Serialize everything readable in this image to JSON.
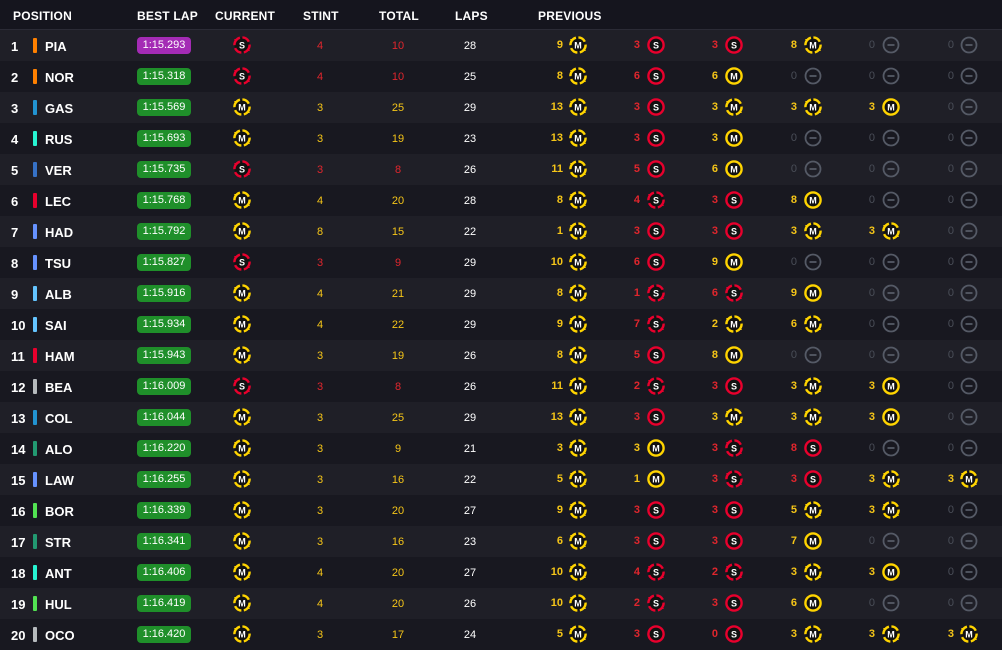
{
  "headers": {
    "position": "POSITION",
    "best_lap": "BEST LAP",
    "current": "CURRENT",
    "stint": "STINT",
    "total": "TOTAL",
    "laps": "LAPS",
    "previous": "PREVIOUS"
  },
  "colors": {
    "soft": "#e8002d",
    "medium": "#ffd400",
    "empty": "#555a66",
    "fastest_lap_purple": "#a42bb5",
    "lap_green": "#1f8f2a",
    "stint_soft_text": "#e0262d",
    "stint_medium_text": "#f5c518"
  },
  "rows": [
    {
      "pos": "1",
      "team_color": "#ff8000",
      "driver": "PIA",
      "best_lap": "1:15.293",
      "purple": true,
      "current": {
        "c": "S",
        "u": true
      },
      "stint": "4",
      "total": "10",
      "laps": "28",
      "prev": [
        {
          "n": "9",
          "c": "M",
          "u": true
        },
        {
          "n": "3",
          "c": "S",
          "u": false
        },
        {
          "n": "3",
          "c": "S",
          "u": false
        },
        {
          "n": "8",
          "c": "M",
          "u": true
        },
        {
          "n": "0",
          "c": "E"
        },
        {
          "n": "0",
          "c": "E"
        }
      ]
    },
    {
      "pos": "2",
      "team_color": "#ff8000",
      "driver": "NOR",
      "best_lap": "1:15.318",
      "purple": false,
      "current": {
        "c": "S",
        "u": true
      },
      "stint": "4",
      "total": "10",
      "laps": "25",
      "prev": [
        {
          "n": "8",
          "c": "M",
          "u": true
        },
        {
          "n": "6",
          "c": "S",
          "u": false
        },
        {
          "n": "6",
          "c": "M",
          "u": false
        },
        {
          "n": "0",
          "c": "E"
        },
        {
          "n": "0",
          "c": "E"
        },
        {
          "n": "0",
          "c": "E"
        }
      ]
    },
    {
      "pos": "3",
      "team_color": "#2293d1",
      "driver": "GAS",
      "best_lap": "1:15.569",
      "purple": false,
      "current": {
        "c": "M",
        "u": true
      },
      "stint": "3",
      "total": "25",
      "laps": "29",
      "prev": [
        {
          "n": "13",
          "c": "M",
          "u": true
        },
        {
          "n": "3",
          "c": "S",
          "u": false
        },
        {
          "n": "3",
          "c": "M",
          "u": true
        },
        {
          "n": "3",
          "c": "M",
          "u": true
        },
        {
          "n": "3",
          "c": "M",
          "u": false
        },
        {
          "n": "0",
          "c": "E"
        }
      ]
    },
    {
      "pos": "4",
      "team_color": "#27f4d2",
      "driver": "RUS",
      "best_lap": "1:15.693",
      "purple": false,
      "current": {
        "c": "M",
        "u": true
      },
      "stint": "3",
      "total": "19",
      "laps": "23",
      "prev": [
        {
          "n": "13",
          "c": "M",
          "u": true
        },
        {
          "n": "3",
          "c": "S",
          "u": false
        },
        {
          "n": "3",
          "c": "M",
          "u": false
        },
        {
          "n": "0",
          "c": "E"
        },
        {
          "n": "0",
          "c": "E"
        },
        {
          "n": "0",
          "c": "E"
        }
      ]
    },
    {
      "pos": "5",
      "team_color": "#3671c6",
      "driver": "VER",
      "best_lap": "1:15.735",
      "purple": false,
      "current": {
        "c": "S",
        "u": true
      },
      "stint": "3",
      "total": "8",
      "laps": "26",
      "prev": [
        {
          "n": "11",
          "c": "M",
          "u": true
        },
        {
          "n": "5",
          "c": "S",
          "u": false
        },
        {
          "n": "6",
          "c": "M",
          "u": false
        },
        {
          "n": "0",
          "c": "E"
        },
        {
          "n": "0",
          "c": "E"
        },
        {
          "n": "0",
          "c": "E"
        }
      ]
    },
    {
      "pos": "6",
      "team_color": "#e8002d",
      "driver": "LEC",
      "best_lap": "1:15.768",
      "purple": false,
      "current": {
        "c": "M",
        "u": true
      },
      "stint": "4",
      "total": "20",
      "laps": "28",
      "prev": [
        {
          "n": "8",
          "c": "M",
          "u": true
        },
        {
          "n": "4",
          "c": "S",
          "u": true
        },
        {
          "n": "3",
          "c": "S",
          "u": false
        },
        {
          "n": "8",
          "c": "M",
          "u": false
        },
        {
          "n": "0",
          "c": "E"
        },
        {
          "n": "0",
          "c": "E"
        }
      ]
    },
    {
      "pos": "7",
      "team_color": "#6692ff",
      "driver": "HAD",
      "best_lap": "1:15.792",
      "purple": false,
      "current": {
        "c": "M",
        "u": true
      },
      "stint": "8",
      "total": "15",
      "laps": "22",
      "prev": [
        {
          "n": "1",
          "c": "M",
          "u": true
        },
        {
          "n": "3",
          "c": "S",
          "u": false
        },
        {
          "n": "3",
          "c": "S",
          "u": false
        },
        {
          "n": "3",
          "c": "M",
          "u": true
        },
        {
          "n": "3",
          "c": "M",
          "u": true
        },
        {
          "n": "0",
          "c": "E"
        }
      ]
    },
    {
      "pos": "8",
      "team_color": "#6692ff",
      "driver": "TSU",
      "best_lap": "1:15.827",
      "purple": false,
      "current": {
        "c": "S",
        "u": true
      },
      "stint": "3",
      "total": "9",
      "laps": "29",
      "prev": [
        {
          "n": "10",
          "c": "M",
          "u": true
        },
        {
          "n": "6",
          "c": "S",
          "u": false
        },
        {
          "n": "9",
          "c": "M",
          "u": false
        },
        {
          "n": "0",
          "c": "E"
        },
        {
          "n": "0",
          "c": "E"
        },
        {
          "n": "0",
          "c": "E"
        }
      ]
    },
    {
      "pos": "9",
      "team_color": "#64c4ff",
      "driver": "ALB",
      "best_lap": "1:15.916",
      "purple": false,
      "current": {
        "c": "M",
        "u": true
      },
      "stint": "4",
      "total": "21",
      "laps": "29",
      "prev": [
        {
          "n": "8",
          "c": "M",
          "u": true
        },
        {
          "n": "1",
          "c": "S",
          "u": true
        },
        {
          "n": "6",
          "c": "S",
          "u": true
        },
        {
          "n": "9",
          "c": "M",
          "u": false
        },
        {
          "n": "0",
          "c": "E"
        },
        {
          "n": "0",
          "c": "E"
        }
      ]
    },
    {
      "pos": "10",
      "team_color": "#64c4ff",
      "driver": "SAI",
      "best_lap": "1:15.934",
      "purple": false,
      "current": {
        "c": "M",
        "u": true
      },
      "stint": "4",
      "total": "22",
      "laps": "29",
      "prev": [
        {
          "n": "9",
          "c": "M",
          "u": true
        },
        {
          "n": "7",
          "c": "S",
          "u": true
        },
        {
          "n": "2",
          "c": "M",
          "u": true
        },
        {
          "n": "6",
          "c": "M",
          "u": true
        },
        {
          "n": "0",
          "c": "E"
        },
        {
          "n": "0",
          "c": "E"
        }
      ]
    },
    {
      "pos": "11",
      "team_color": "#e8002d",
      "driver": "HAM",
      "best_lap": "1:15.943",
      "purple": false,
      "current": {
        "c": "M",
        "u": true
      },
      "stint": "3",
      "total": "19",
      "laps": "26",
      "prev": [
        {
          "n": "8",
          "c": "M",
          "u": true
        },
        {
          "n": "5",
          "c": "S",
          "u": false
        },
        {
          "n": "8",
          "c": "M",
          "u": false
        },
        {
          "n": "0",
          "c": "E"
        },
        {
          "n": "0",
          "c": "E"
        },
        {
          "n": "0",
          "c": "E"
        }
      ]
    },
    {
      "pos": "12",
      "team_color": "#b6babd",
      "driver": "BEA",
      "best_lap": "1:16.009",
      "purple": false,
      "current": {
        "c": "S",
        "u": true
      },
      "stint": "3",
      "total": "8",
      "laps": "26",
      "prev": [
        {
          "n": "11",
          "c": "M",
          "u": true
        },
        {
          "n": "2",
          "c": "S",
          "u": true
        },
        {
          "n": "3",
          "c": "S",
          "u": false
        },
        {
          "n": "3",
          "c": "M",
          "u": true
        },
        {
          "n": "3",
          "c": "M",
          "u": false
        },
        {
          "n": "0",
          "c": "E"
        }
      ]
    },
    {
      "pos": "13",
      "team_color": "#2293d1",
      "driver": "COL",
      "best_lap": "1:16.044",
      "purple": false,
      "current": {
        "c": "M",
        "u": true
      },
      "stint": "3",
      "total": "25",
      "laps": "29",
      "prev": [
        {
          "n": "13",
          "c": "M",
          "u": true
        },
        {
          "n": "3",
          "c": "S",
          "u": false
        },
        {
          "n": "3",
          "c": "M",
          "u": true
        },
        {
          "n": "3",
          "c": "M",
          "u": true
        },
        {
          "n": "3",
          "c": "M",
          "u": false
        },
        {
          "n": "0",
          "c": "E"
        }
      ]
    },
    {
      "pos": "14",
      "team_color": "#229971",
      "driver": "ALO",
      "best_lap": "1:16.220",
      "purple": false,
      "current": {
        "c": "M",
        "u": true
      },
      "stint": "3",
      "total": "9",
      "laps": "21",
      "prev": [
        {
          "n": "3",
          "c": "M",
          "u": true
        },
        {
          "n": "3",
          "c": "M",
          "u": false
        },
        {
          "n": "3",
          "c": "S",
          "u": true
        },
        {
          "n": "8",
          "c": "S",
          "u": false
        },
        {
          "n": "0",
          "c": "E"
        },
        {
          "n": "0",
          "c": "E"
        }
      ]
    },
    {
      "pos": "15",
      "team_color": "#6692ff",
      "driver": "LAW",
      "best_lap": "1:16.255",
      "purple": false,
      "current": {
        "c": "M",
        "u": true
      },
      "stint": "3",
      "total": "16",
      "laps": "22",
      "prev": [
        {
          "n": "5",
          "c": "M",
          "u": true
        },
        {
          "n": "1",
          "c": "M",
          "u": false
        },
        {
          "n": "3",
          "c": "S",
          "u": true
        },
        {
          "n": "3",
          "c": "S",
          "u": false
        },
        {
          "n": "3",
          "c": "M",
          "u": true
        },
        {
          "n": "3",
          "c": "M",
          "u": true
        }
      ]
    },
    {
      "pos": "16",
      "team_color": "#52e252",
      "driver": "BOR",
      "best_lap": "1:16.339",
      "purple": false,
      "current": {
        "c": "M",
        "u": true
      },
      "stint": "3",
      "total": "20",
      "laps": "27",
      "prev": [
        {
          "n": "9",
          "c": "M",
          "u": true
        },
        {
          "n": "3",
          "c": "S",
          "u": false
        },
        {
          "n": "3",
          "c": "S",
          "u": false
        },
        {
          "n": "5",
          "c": "M",
          "u": true
        },
        {
          "n": "3",
          "c": "M",
          "u": true
        },
        {
          "n": "0",
          "c": "E"
        }
      ]
    },
    {
      "pos": "17",
      "team_color": "#229971",
      "driver": "STR",
      "best_lap": "1:16.341",
      "purple": false,
      "current": {
        "c": "M",
        "u": true
      },
      "stint": "3",
      "total": "16",
      "laps": "23",
      "prev": [
        {
          "n": "6",
          "c": "M",
          "u": true
        },
        {
          "n": "3",
          "c": "S",
          "u": false
        },
        {
          "n": "3",
          "c": "S",
          "u": false
        },
        {
          "n": "7",
          "c": "M",
          "u": false
        },
        {
          "n": "0",
          "c": "E"
        },
        {
          "n": "0",
          "c": "E"
        }
      ]
    },
    {
      "pos": "18",
      "team_color": "#27f4d2",
      "driver": "ANT",
      "best_lap": "1:16.406",
      "purple": false,
      "current": {
        "c": "M",
        "u": true
      },
      "stint": "4",
      "total": "20",
      "laps": "27",
      "prev": [
        {
          "n": "10",
          "c": "M",
          "u": true
        },
        {
          "n": "4",
          "c": "S",
          "u": true
        },
        {
          "n": "2",
          "c": "S",
          "u": true
        },
        {
          "n": "3",
          "c": "M",
          "u": true
        },
        {
          "n": "3",
          "c": "M",
          "u": false
        },
        {
          "n": "0",
          "c": "E"
        }
      ]
    },
    {
      "pos": "19",
      "team_color": "#52e252",
      "driver": "HUL",
      "best_lap": "1:16.419",
      "purple": false,
      "current": {
        "c": "M",
        "u": true
      },
      "stint": "4",
      "total": "20",
      "laps": "26",
      "prev": [
        {
          "n": "10",
          "c": "M",
          "u": true
        },
        {
          "n": "2",
          "c": "S",
          "u": true
        },
        {
          "n": "3",
          "c": "S",
          "u": false
        },
        {
          "n": "6",
          "c": "M",
          "u": false
        },
        {
          "n": "0",
          "c": "E"
        },
        {
          "n": "0",
          "c": "E"
        }
      ]
    },
    {
      "pos": "20",
      "team_color": "#b6babd",
      "driver": "OCO",
      "best_lap": "1:16.420",
      "purple": false,
      "current": {
        "c": "M",
        "u": true
      },
      "stint": "3",
      "total": "17",
      "laps": "24",
      "prev": [
        {
          "n": "5",
          "c": "M",
          "u": true
        },
        {
          "n": "3",
          "c": "S",
          "u": false
        },
        {
          "n": "0",
          "c": "S",
          "u": false
        },
        {
          "n": "3",
          "c": "M",
          "u": true
        },
        {
          "n": "3",
          "c": "M",
          "u": true
        },
        {
          "n": "3",
          "c": "M",
          "u": true
        }
      ]
    }
  ]
}
